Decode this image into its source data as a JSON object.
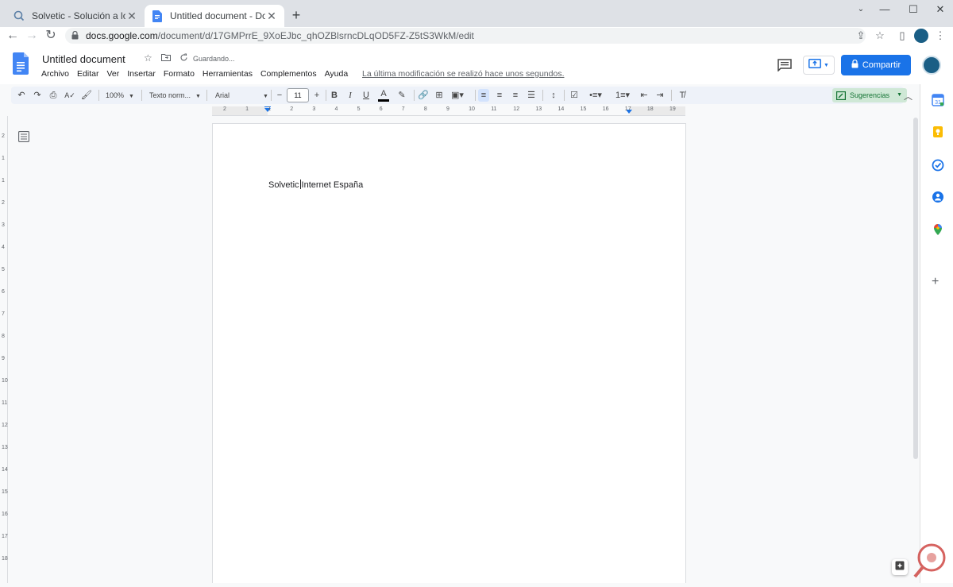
{
  "browser": {
    "tabs": [
      {
        "title": "Solvetic - Solución a los problema",
        "active": false
      },
      {
        "title": "Untitled document - Documentos",
        "active": true
      }
    ],
    "url_host": "docs.google.com",
    "url_path": "/document/d/17GMPrrE_9XoEJbc_qhOZBlsrncDLqOD5FZ-Z5tS3WkM/edit"
  },
  "docs": {
    "title": "Untitled document",
    "saving_status": "Guardando...",
    "menu": [
      "Archivo",
      "Editar",
      "Ver",
      "Insertar",
      "Formato",
      "Herramientas",
      "Complementos",
      "Ayuda"
    ],
    "last_modified": "La última modificación se realizó hace unos segundos.",
    "share_label": "Compartir"
  },
  "toolbar": {
    "zoom": "100%",
    "style": "Texto norm...",
    "font": "Arial",
    "font_size": "11",
    "mode": "Sugerencias"
  },
  "ruler": {
    "numbers": [
      "2",
      "1",
      "1",
      "2",
      "3",
      "4",
      "5",
      "6",
      "7",
      "8",
      "9",
      "10",
      "11",
      "12",
      "13",
      "14",
      "15",
      "16",
      "17",
      "18",
      "19"
    ],
    "vertical_numbers": [
      "2",
      "1",
      "1",
      "2",
      "3",
      "4",
      "5",
      "6",
      "7",
      "8",
      "9",
      "10",
      "11",
      "12",
      "13",
      "14",
      "15",
      "16",
      "17",
      "18"
    ]
  },
  "document": {
    "text_before_cursor": "Solvetic",
    "text_after_cursor": "Internet España"
  },
  "colors": {
    "accent": "#1a73e8",
    "toolbar_bg": "#eef2f9",
    "suggest_bg": "#cfe8d6"
  }
}
